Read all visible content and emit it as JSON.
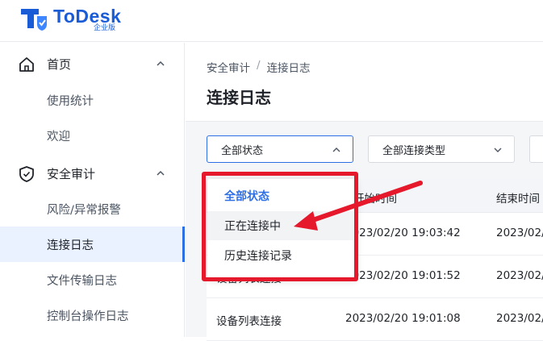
{
  "header": {
    "brand": "ToDesk",
    "edition": "企业版"
  },
  "sidebar": {
    "groups": [
      {
        "label": "首页",
        "items": [
          "使用统计",
          "欢迎"
        ]
      },
      {
        "label": "安全审计",
        "items": [
          "风险/异常报警",
          "连接日志",
          "文件传输日志",
          "控制台操作日志"
        ]
      }
    ],
    "active_item": "连接日志"
  },
  "breadcrumb": [
    "安全审计",
    "/",
    "连接日志"
  ],
  "page_title": "连接日志",
  "filters": {
    "status_value": "全部状态",
    "type_value": "全部连接类型"
  },
  "status_dropdown": {
    "options": [
      "全部状态",
      "正在连接中",
      "历史连接记录"
    ],
    "selected": "全部状态",
    "hovered": "正在连接中"
  },
  "table": {
    "columns": [
      "开始时间",
      "结束时间"
    ],
    "rows": [
      {
        "type": "",
        "start": "2023/02/20 19:03:42",
        "end": "2023/02/"
      },
      {
        "type": "设备列表连接",
        "start": "2023/02/20 19:01:52",
        "end": "2023/02/"
      },
      {
        "type": "设备列表连接",
        "start": "2023/02/20 19:01:08",
        "end": "2023/02/"
      }
    ]
  },
  "colors": {
    "brand": "#1a5bd6",
    "accent": "#2f6fe4",
    "annotation": "#e5182c"
  }
}
